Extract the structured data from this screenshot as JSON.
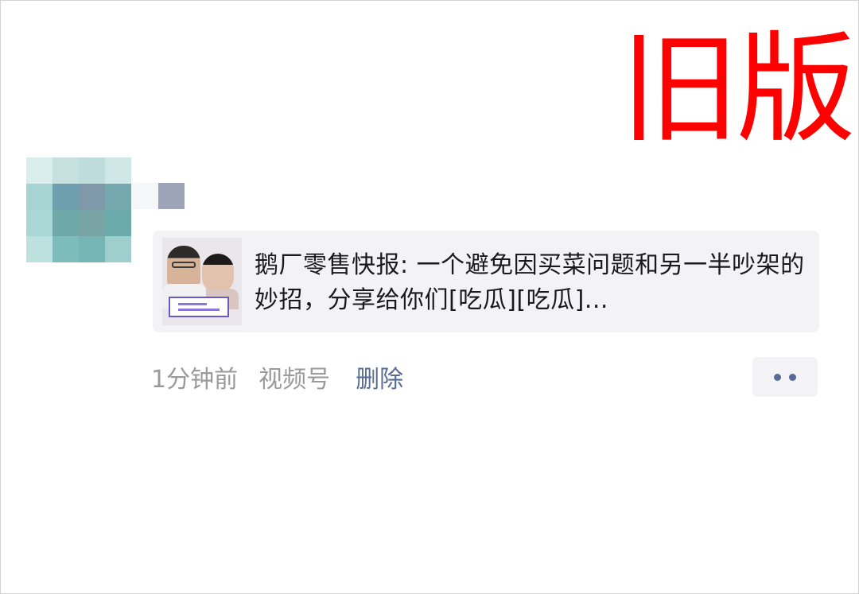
{
  "annotation": {
    "label": "旧版",
    "color": "#ff0000"
  },
  "post": {
    "avatar_icon": "pixelated-avatar-icon",
    "shared_card": {
      "thumbnail_icon": "video-thumbnail-icon",
      "title": "鹅厂零售快报: 一个避免因买菜问题和另一半吵架的妙招，分享给你们[吃瓜][吃瓜]..."
    },
    "meta": {
      "time": "1分钟前",
      "source": "视频号",
      "delete_label": "删除",
      "more_icon": "more-dots-icon"
    }
  },
  "colors": {
    "link": "#576b95",
    "muted": "#9a9a9a",
    "card_background": "#f3f3f5"
  }
}
